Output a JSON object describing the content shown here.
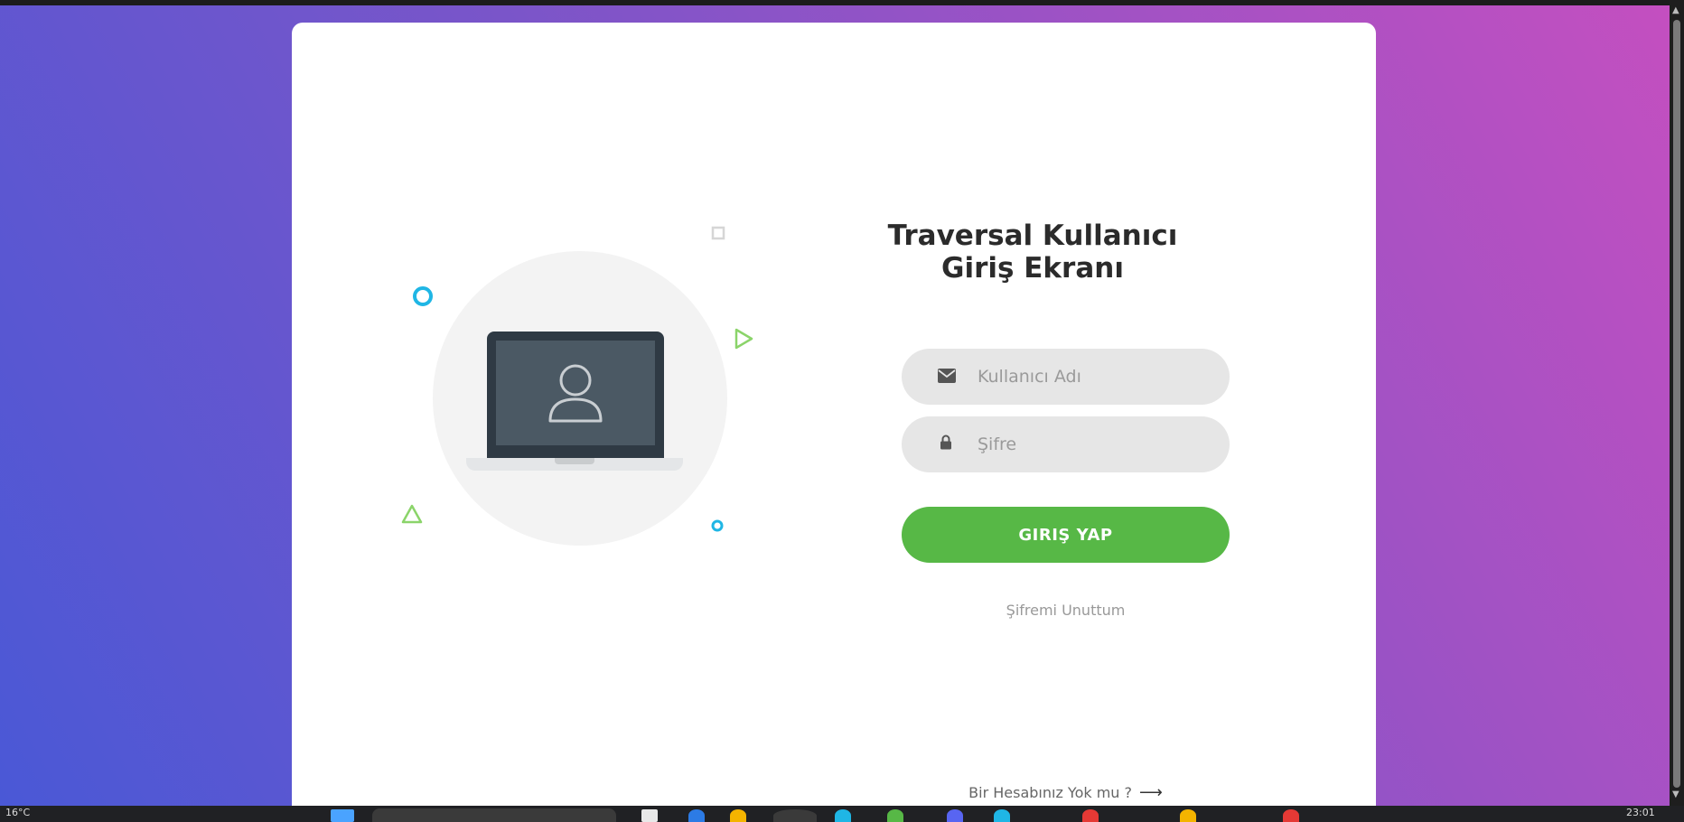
{
  "login": {
    "title_line1": "Traversal Kullanıcı",
    "title_line2": "Giriş Ekranı",
    "username_placeholder": "Kullanıcı Adı",
    "password_placeholder": "Şifre",
    "login_button": "GIRIŞ YAP",
    "forgot_link": "Şifremi Unuttum",
    "signup_link": "Bir Hesabınız Yok mu ?",
    "signup_arrow": "⟶"
  },
  "colors": {
    "gradient_left": "#4a58d6",
    "gradient_right": "#c44fc0",
    "button_green": "#57b846",
    "input_bg": "#e6e6e6",
    "deco_blue": "#1fb6e5",
    "deco_green": "#8bd46a"
  },
  "icons": {
    "username": "envelope-icon",
    "password": "lock-icon",
    "illustration_user": "user-icon"
  },
  "taskbar": {
    "weather": "16°C",
    "clock": "23:01"
  }
}
